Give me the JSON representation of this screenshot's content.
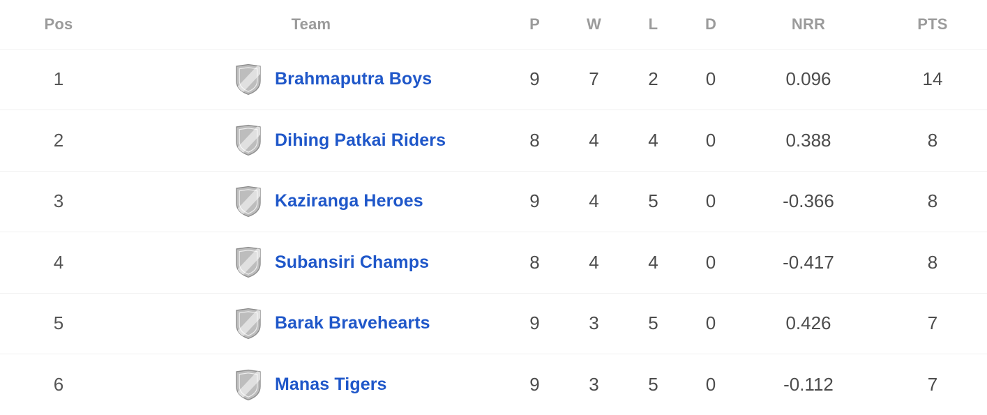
{
  "table": {
    "name": "points-table",
    "columns": [
      {
        "key": "pos",
        "label": "Pos"
      },
      {
        "key": "team",
        "label": "Team"
      },
      {
        "key": "p",
        "label": "P"
      },
      {
        "key": "w",
        "label": "W"
      },
      {
        "key": "l",
        "label": "L"
      },
      {
        "key": "d",
        "label": "D"
      },
      {
        "key": "nrr",
        "label": "NRR"
      },
      {
        "key": "pts",
        "label": "PTS"
      }
    ],
    "rows": [
      {
        "pos": "1",
        "team": "Brahmaputra Boys",
        "icon": "shield-icon",
        "p": "9",
        "w": "7",
        "l": "2",
        "d": "0",
        "nrr": "0.096",
        "pts": "14"
      },
      {
        "pos": "2",
        "team": "Dihing Patkai Riders",
        "icon": "shield-icon",
        "p": "8",
        "w": "4",
        "l": "4",
        "d": "0",
        "nrr": "0.388",
        "pts": "8"
      },
      {
        "pos": "3",
        "team": "Kaziranga Heroes",
        "icon": "shield-icon",
        "p": "9",
        "w": "4",
        "l": "5",
        "d": "0",
        "nrr": "-0.366",
        "pts": "8"
      },
      {
        "pos": "4",
        "team": "Subansiri Champs",
        "icon": "shield-icon",
        "p": "8",
        "w": "4",
        "l": "4",
        "d": "0",
        "nrr": "-0.417",
        "pts": "8"
      },
      {
        "pos": "5",
        "team": "Barak Bravehearts",
        "icon": "shield-icon",
        "p": "9",
        "w": "3",
        "l": "5",
        "d": "0",
        "nrr": "0.426",
        "pts": "7"
      },
      {
        "pos": "6",
        "team": "Manas Tigers",
        "icon": "shield-icon",
        "p": "9",
        "w": "3",
        "l": "5",
        "d": "0",
        "nrr": "-0.112",
        "pts": "7"
      }
    ]
  },
  "colors": {
    "team_link": "#1f57c9",
    "header_text": "#9b9b9b",
    "cell_text": "#4c4c4c",
    "row_divider": "#f1f1f1",
    "shield_fill": "#b9b9b9",
    "shield_stripe": "#dcdcdc",
    "shield_outline": "#8e8e8e",
    "background": "#ffffff"
  }
}
